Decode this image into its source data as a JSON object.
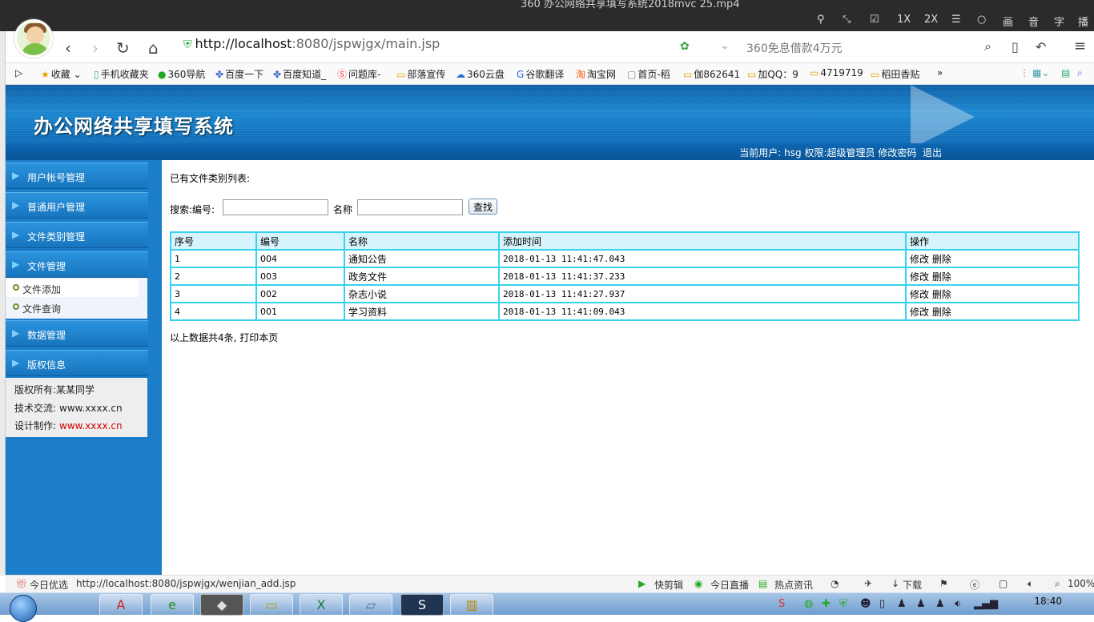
{
  "player": {
    "title": "360 办公网络共享填写系统2018mvc 25.mp4",
    "controls": [
      "1X",
      "2X",
      "画",
      "音",
      "字",
      "播"
    ]
  },
  "browser": {
    "url_host": "http://localhost",
    "url_path": ":8080/jspwjgx/main.jsp",
    "search_placeholder": "360免息借款4万元",
    "bookmarks": [
      "收藏",
      "手机收藏夹",
      "360导航",
      "百度一下",
      "百度知道_",
      "问题库-",
      "部落宣传",
      "360云盘",
      "谷歌翻译",
      "淘宝网",
      "首页-稻",
      "伽862641",
      "加QQ：9",
      "4719719",
      "稻田香贴",
      "»"
    ]
  },
  "header": {
    "system_title": "办公网络共享填写系统",
    "current_user_label": "当前用户:",
    "username": "hsg",
    "role_label": "权限:",
    "role": "超级管理员",
    "change_password": "修改密码",
    "logout": "退出"
  },
  "sidebar": {
    "menus": [
      {
        "label": "用户帐号管理"
      },
      {
        "label": "普通用户管理"
      },
      {
        "label": "文件类别管理"
      },
      {
        "label": "文件管理"
      },
      {
        "label": "数据管理"
      },
      {
        "label": "版权信息"
      }
    ],
    "submenu": [
      {
        "label": "文件添加"
      },
      {
        "label": "文件查询"
      }
    ],
    "copyright": {
      "owner_label": "版权所有:",
      "owner": "某某同学",
      "tech_label": "技术交流:",
      "tech": "www.xxxx.cn",
      "design_label": "设计制作:",
      "design": "www.xxxx.cn"
    }
  },
  "main": {
    "heading": "已有文件类别列表:",
    "search": {
      "label_id": "搜索:编号:",
      "label_name": "名称",
      "id_value": "",
      "name_value": "",
      "button": "查找"
    },
    "table": {
      "headers": [
        "序号",
        "编号",
        "名称",
        "添加时间",
        "操作"
      ],
      "rows": [
        {
          "seq": "1",
          "code": "004",
          "name": "通知公告",
          "time": "2018-01-13 11:41:47.043",
          "edit": "修改",
          "del": "删除"
        },
        {
          "seq": "2",
          "code": "003",
          "name": "政务文件",
          "time": "2018-01-13 11:41:37.233",
          "edit": "修改",
          "del": "删除"
        },
        {
          "seq": "3",
          "code": "002",
          "name": "杂志小说",
          "time": "2018-01-13 11:41:27.937",
          "edit": "修改",
          "del": "删除"
        },
        {
          "seq": "4",
          "code": "001",
          "name": "学习资料",
          "time": "2018-01-13 11:41:09.043",
          "edit": "修改",
          "del": "删除"
        }
      ]
    },
    "footer_text": "以上数据共4条,",
    "print_link": "打印本页"
  },
  "statusbar": {
    "left_label": "今日优选",
    "url": "http://localhost:8080/jspwjgx/wenjian_add.jsp",
    "items": [
      "快剪辑",
      "今日直播",
      "热点资讯",
      "下载"
    ],
    "zoom": "100%"
  },
  "taskbar": {
    "time": "18:40"
  }
}
